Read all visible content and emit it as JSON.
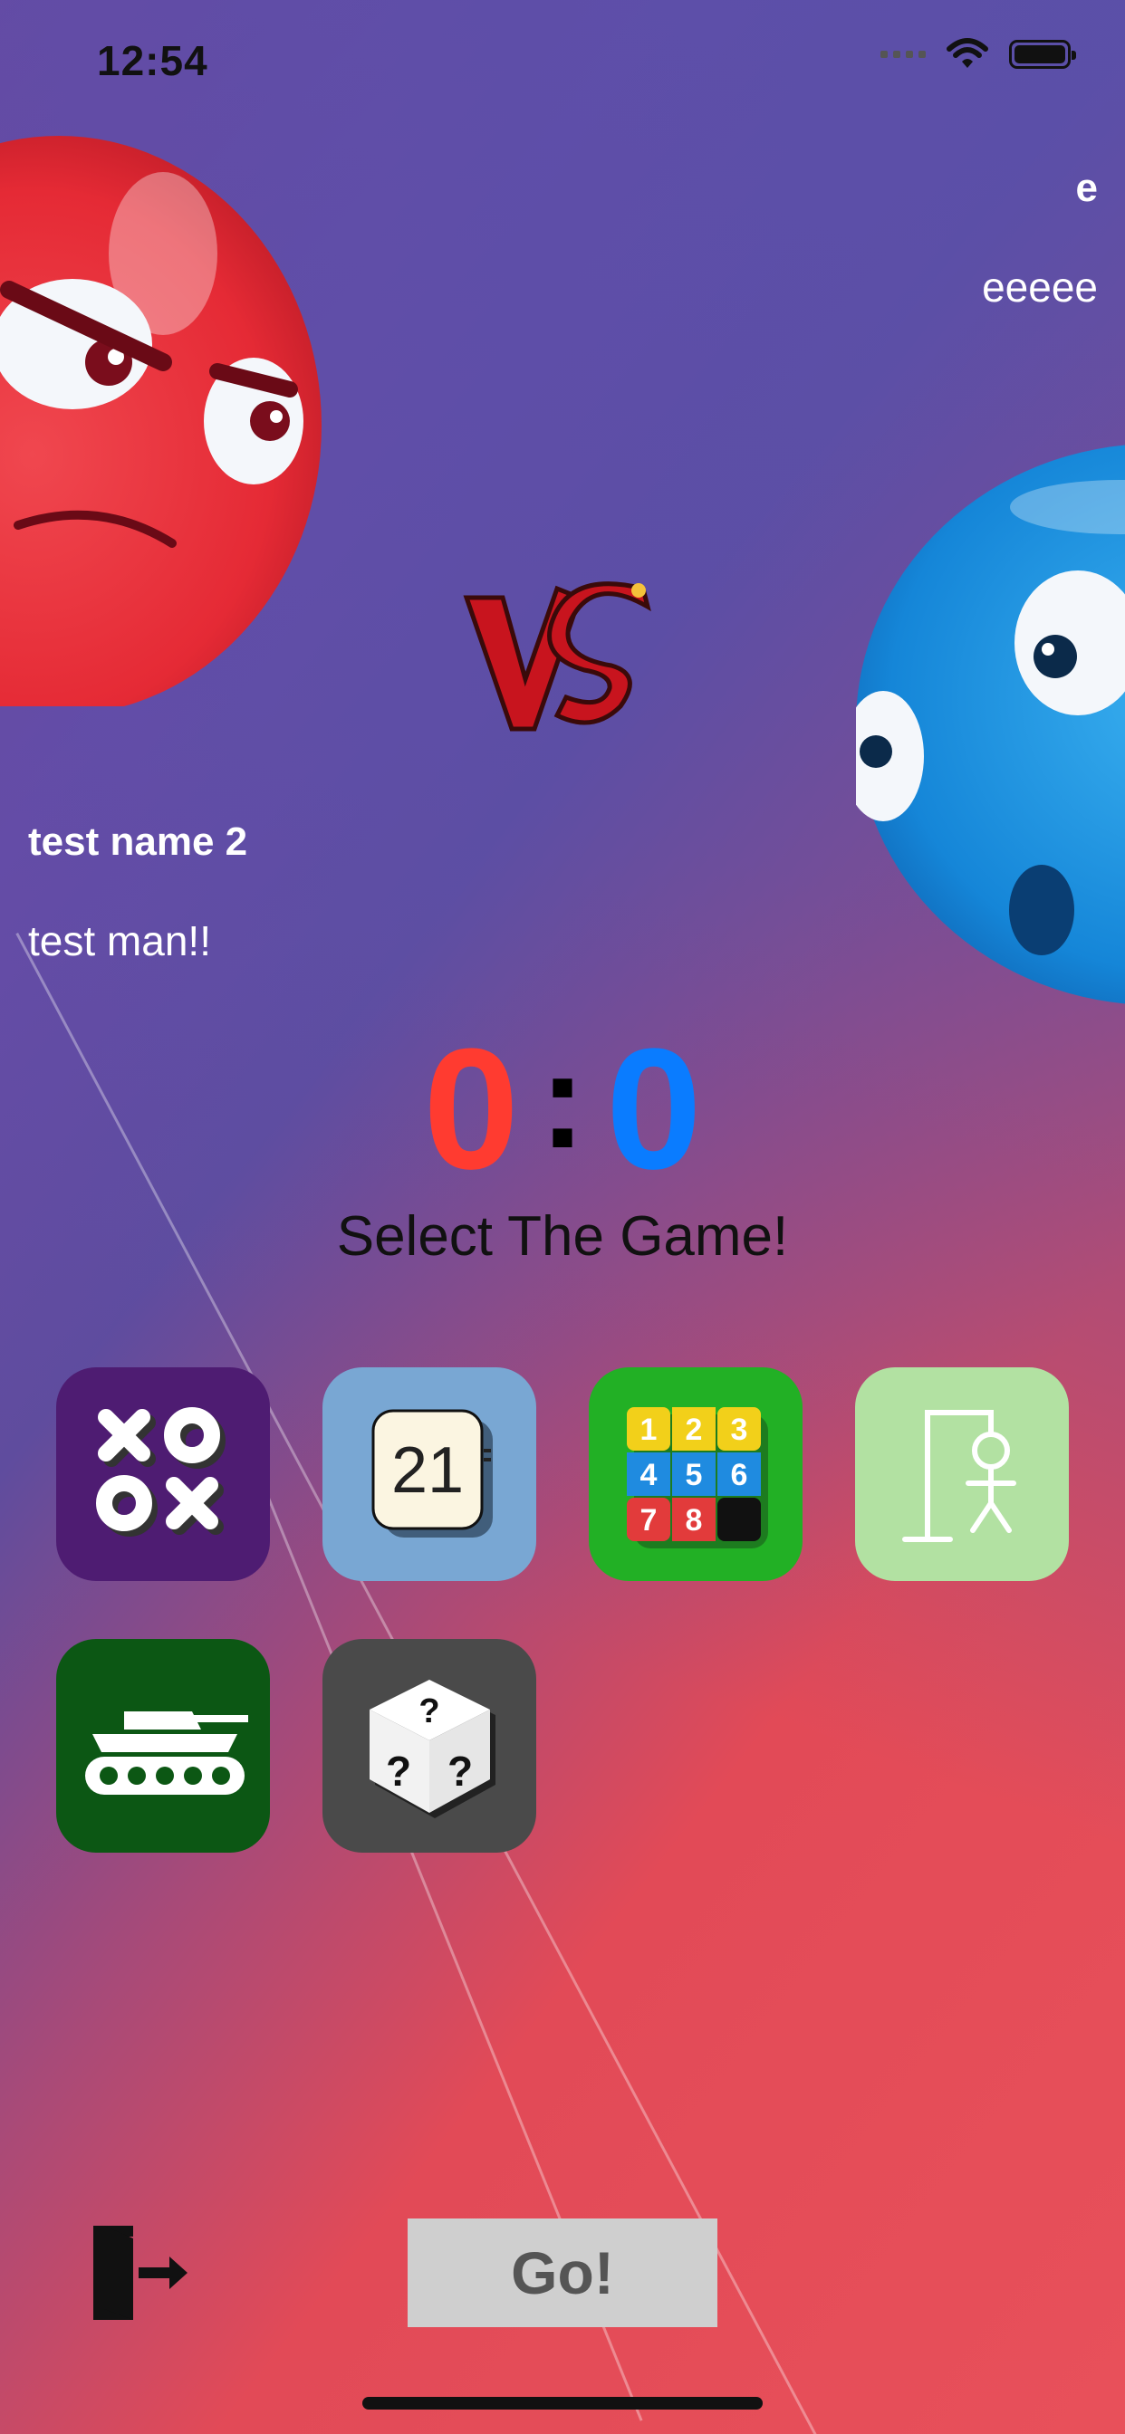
{
  "status_bar": {
    "time": "12:54"
  },
  "opponent": {
    "name": "e",
    "status": "eeeee"
  },
  "player": {
    "name": "test name 2",
    "status": "test man!!"
  },
  "score": {
    "player": "0",
    "separator": ":",
    "opponent": "0"
  },
  "select_title": "Select The Game!",
  "games": [
    {
      "icon": "tic-tac-toe-icon"
    },
    {
      "icon": "twenty-one-icon",
      "label": "21"
    },
    {
      "icon": "sliding-puzzle-icon",
      "tiles": [
        "1",
        "2",
        "3",
        "4",
        "5",
        "6",
        "7",
        "8"
      ]
    },
    {
      "icon": "hangman-icon"
    },
    {
      "icon": "tank-icon"
    },
    {
      "icon": "dice-icon",
      "glyph": "?"
    }
  ],
  "go_button": "Go!",
  "colors": {
    "player": "#ff3b30",
    "opponent": "#0a7cff"
  }
}
